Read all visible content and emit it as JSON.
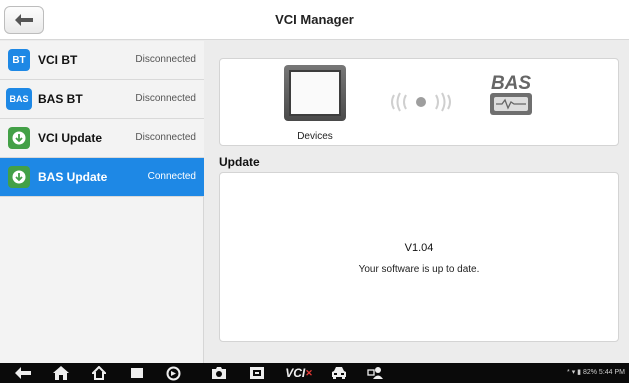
{
  "header": {
    "title": "VCI Manager"
  },
  "sidebar": {
    "items": [
      {
        "badge": "BT",
        "label": "VCI BT",
        "status": "Disconnected",
        "color": "#1e88e5"
      },
      {
        "badge": "BAS",
        "label": "BAS BT",
        "status": "Disconnected",
        "color": "#1e88e5"
      },
      {
        "label": "VCI Update",
        "status": "Disconnected",
        "color": "#43a047",
        "icon": "download-icon"
      },
      {
        "label": "BAS Update",
        "status": "Connected",
        "color": "#43a047",
        "icon": "download-icon"
      }
    ]
  },
  "devices": {
    "label": "Devices",
    "bas_text": "BAS"
  },
  "update": {
    "heading": "Update",
    "version": "V1.04",
    "message": "Your software is up to date."
  },
  "navbar": {
    "icons": [
      "back-icon",
      "home-icon",
      "house-icon",
      "recent-apps-icon",
      "browser-icon",
      "camera-icon",
      "screenshot-icon",
      "vci-icon",
      "car-icon",
      "remote-icon"
    ],
    "vci_text": "VCI",
    "status": "* ▾ ▮ 82% 5:44 PM"
  },
  "colors": {
    "accent": "#1e88e5",
    "green": "#43a047",
    "vci_red": "#e53935"
  }
}
